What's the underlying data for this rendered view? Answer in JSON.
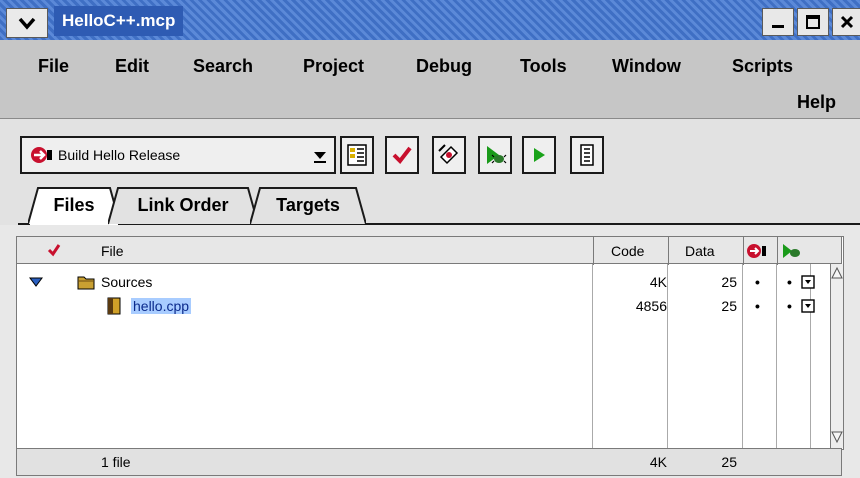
{
  "window": {
    "title": "HelloC++.mcp"
  },
  "menubar": {
    "items": [
      "File",
      "Edit",
      "Search",
      "Project",
      "Debug",
      "Tools",
      "Window",
      "Scripts",
      "Help"
    ]
  },
  "toolbar": {
    "target": "Build Hello Release",
    "buttons": [
      "target-settings",
      "check-syntax",
      "compile",
      "debug",
      "run",
      "project-inspector"
    ]
  },
  "tabs": [
    {
      "label": "Files",
      "active": true
    },
    {
      "label": "Link Order",
      "active": false
    },
    {
      "label": "Targets",
      "active": false
    }
  ],
  "table": {
    "columns": {
      "file": "File",
      "code": "Code",
      "data": "Data"
    },
    "rows": [
      {
        "name": "Sources",
        "type": "group",
        "code": "4K",
        "data": "25",
        "bullet1": "•",
        "bullet2": "•"
      },
      {
        "name": "hello.cpp",
        "type": "file",
        "code": "4856",
        "data": "25",
        "bullet1": "•",
        "bullet2": "•",
        "selected": true
      }
    ],
    "footer": {
      "count": "1 file",
      "code": "4K",
      "data": "25"
    }
  },
  "colors": {
    "title_bar": "#3f6fc4",
    "selection": "#a8ccff",
    "checkmark": "#c8102e"
  }
}
